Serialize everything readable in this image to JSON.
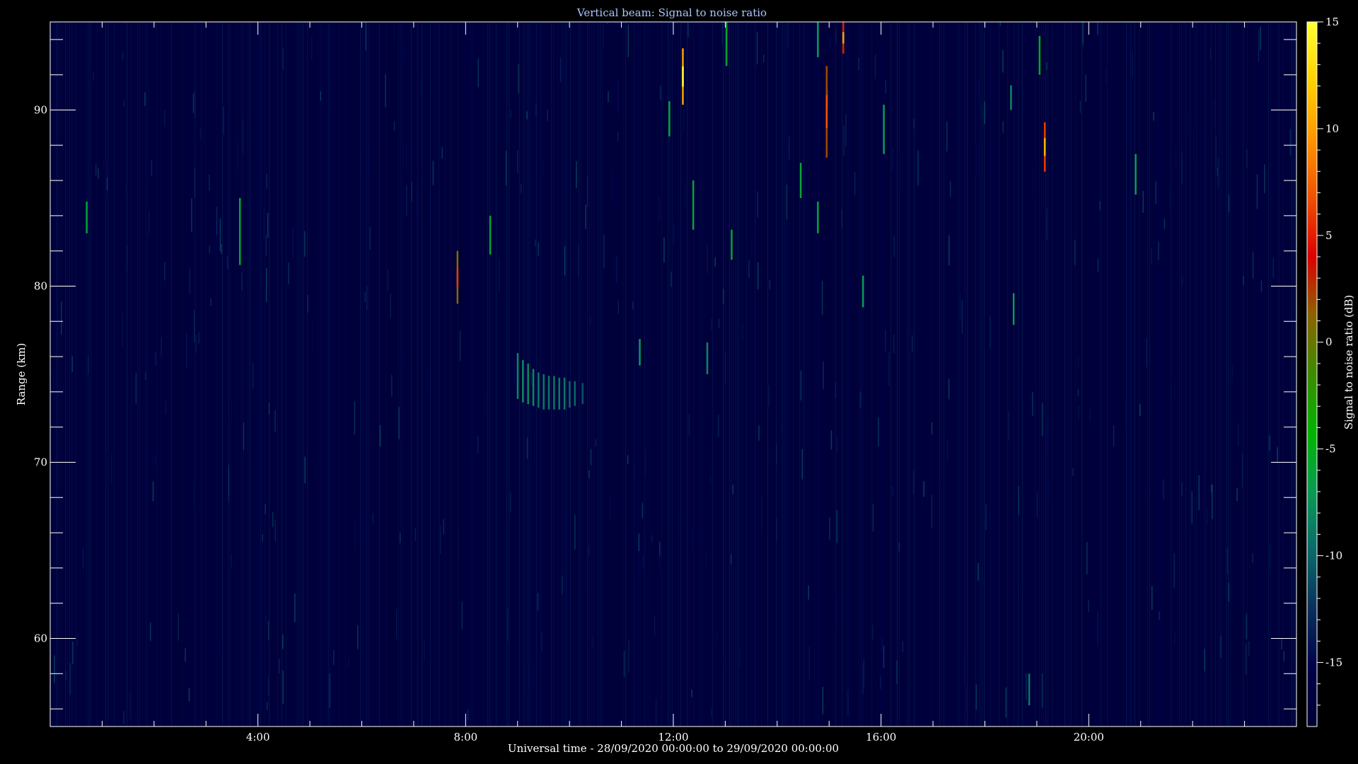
{
  "chart_data": {
    "type": "heatmap",
    "title": "Vertical beam: Signal to noise ratio",
    "xlabel": "Universal time - 28/09/2020 00:00:00 to 29/09/2020 00:00:00",
    "ylabel": "Range (km)",
    "x_unit": "hours UT",
    "xlim": [
      0,
      24
    ],
    "ylim": [
      55,
      95
    ],
    "x_ticks": [
      {
        "value": 4,
        "label": "4:00"
      },
      {
        "value": 8,
        "label": "8:00"
      },
      {
        "value": 12,
        "label": "12:00"
      },
      {
        "value": 16,
        "label": "16:00"
      },
      {
        "value": 20,
        "label": "20:00"
      }
    ],
    "y_ticks": [
      {
        "value": 60,
        "label": "60"
      },
      {
        "value": 70,
        "label": "70"
      },
      {
        "value": 80,
        "label": "80"
      },
      {
        "value": 90,
        "label": "90"
      }
    ],
    "background_snr_db": -17,
    "colorbar": {
      "label": "Signal to noise ratio (dB)",
      "min": -18,
      "max": 15,
      "ticks": [
        {
          "value": 15,
          "label": "15"
        },
        {
          "value": 10,
          "label": "10"
        },
        {
          "value": 5,
          "label": "5"
        },
        {
          "value": 0,
          "label": "0"
        },
        {
          "value": -5,
          "label": "-5"
        },
        {
          "value": -10,
          "label": "-10"
        },
        {
          "value": -15,
          "label": "-15"
        }
      ],
      "colors": [
        "#000033",
        "#00004a",
        "#08305c",
        "#0a6a6a",
        "#0a9a55",
        "#00b400",
        "#3c8c00",
        "#8c6400",
        "#dc0000",
        "#f05000",
        "#ff9600",
        "#ffd200",
        "#ffff32"
      ]
    },
    "features": [
      {
        "t": 0.7,
        "r0": 83.0,
        "r1": 84.8,
        "snr": -6
      },
      {
        "t": 3.65,
        "r0": 81.2,
        "r1": 85.0,
        "snr": -6
      },
      {
        "t": 7.84,
        "r0": 79.0,
        "r1": 82.0,
        "snr": 1
      },
      {
        "t": 8.47,
        "r0": 81.8,
        "r1": 84.0,
        "snr": -6
      },
      {
        "t": 11.35,
        "r0": 75.5,
        "r1": 77.0,
        "snr": -7
      },
      {
        "t": 11.92,
        "r0": 88.5,
        "r1": 90.5,
        "snr": -6
      },
      {
        "t": 12.18,
        "r0": 90.3,
        "r1": 93.5,
        "snr": 10
      },
      {
        "t": 12.38,
        "r0": 83.2,
        "r1": 86.0,
        "snr": -6
      },
      {
        "t": 12.65,
        "r0": 75.0,
        "r1": 76.8,
        "snr": -8
      },
      {
        "t": 13.02,
        "r0": 92.5,
        "r1": 95.0,
        "snr": -6
      },
      {
        "t": 13.12,
        "r0": 81.5,
        "r1": 83.2,
        "snr": -6
      },
      {
        "t": 14.45,
        "r0": 85.0,
        "r1": 87.0,
        "snr": -6
      },
      {
        "t": 14.78,
        "r0": 83.0,
        "r1": 84.8,
        "snr": -6
      },
      {
        "t": 14.78,
        "r0": 93.0,
        "r1": 95.0,
        "snr": -7
      },
      {
        "t": 14.95,
        "r0": 87.3,
        "r1": 92.5,
        "snr": 2
      },
      {
        "t": 15.27,
        "r0": 93.2,
        "r1": 95.0,
        "snr": 5
      },
      {
        "t": 15.65,
        "r0": 78.8,
        "r1": 80.6,
        "snr": -7
      },
      {
        "t": 16.05,
        "r0": 87.5,
        "r1": 90.3,
        "snr": -7
      },
      {
        "t": 18.5,
        "r0": 90.0,
        "r1": 91.4,
        "snr": -8
      },
      {
        "t": 18.55,
        "r0": 77.8,
        "r1": 79.6,
        "snr": -7
      },
      {
        "t": 18.85,
        "r0": 56.2,
        "r1": 58.0,
        "snr": -9
      },
      {
        "t": 19.05,
        "r0": 92.0,
        "r1": 94.2,
        "snr": -5
      },
      {
        "t": 19.15,
        "r0": 86.5,
        "r1": 89.3,
        "snr": 6
      },
      {
        "t": 20.9,
        "r0": 85.2,
        "r1": 87.5,
        "snr": -7
      },
      {
        "t": 9.0,
        "r0": 73.6,
        "r1": 76.2,
        "snr": -8
      },
      {
        "t": 9.1,
        "r0": 73.4,
        "r1": 75.8,
        "snr": -8
      },
      {
        "t": 9.2,
        "r0": 73.3,
        "r1": 75.6,
        "snr": -8
      },
      {
        "t": 9.3,
        "r0": 73.2,
        "r1": 75.3,
        "snr": -8
      },
      {
        "t": 9.4,
        "r0": 73.1,
        "r1": 75.1,
        "snr": -9
      },
      {
        "t": 9.5,
        "r0": 73.0,
        "r1": 75.0,
        "snr": -9
      },
      {
        "t": 9.6,
        "r0": 73.0,
        "r1": 74.9,
        "snr": -9
      },
      {
        "t": 9.7,
        "r0": 73.0,
        "r1": 74.9,
        "snr": -9
      },
      {
        "t": 9.8,
        "r0": 73.0,
        "r1": 74.8,
        "snr": -9
      },
      {
        "t": 9.9,
        "r0": 73.0,
        "r1": 74.8,
        "snr": -9
      },
      {
        "t": 10.0,
        "r0": 73.1,
        "r1": 74.6,
        "snr": -10
      },
      {
        "t": 10.1,
        "r0": 73.2,
        "r1": 74.6,
        "snr": -10
      },
      {
        "t": 10.25,
        "r0": 73.3,
        "r1": 74.5,
        "snr": -11
      }
    ]
  }
}
